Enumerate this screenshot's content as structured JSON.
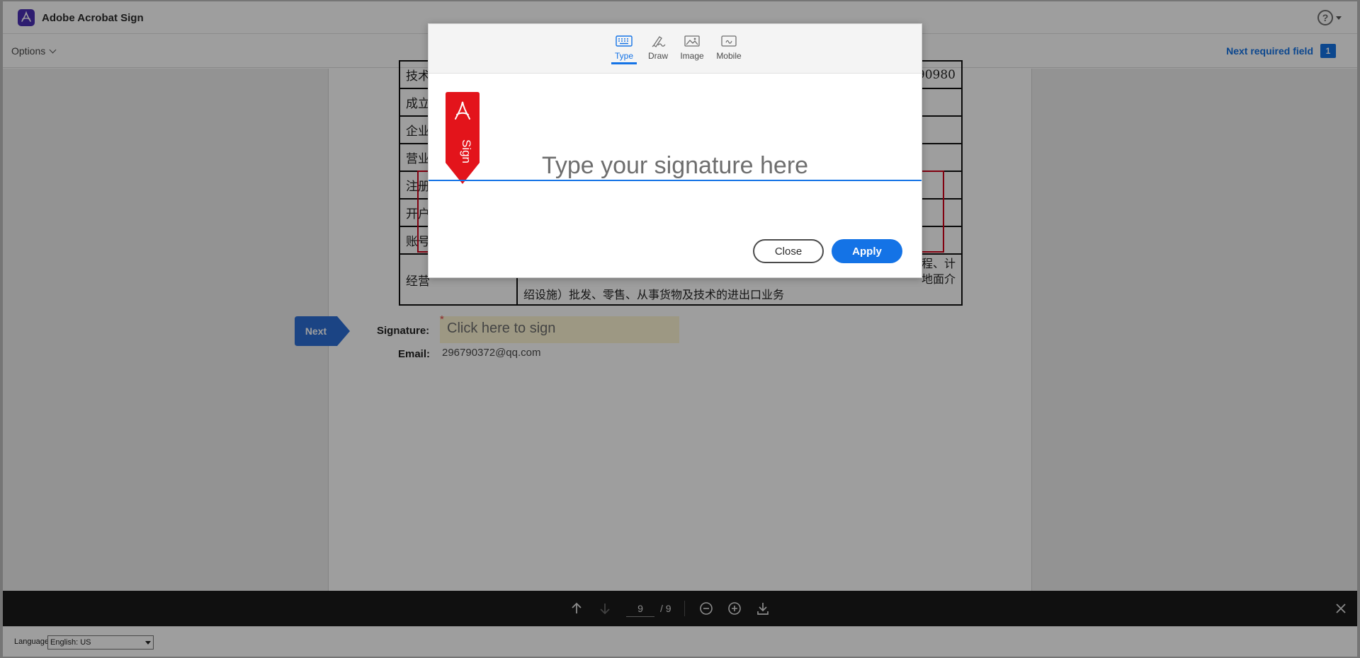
{
  "app": {
    "title": "Adobe Acrobat Sign",
    "help_icon": "help-icon"
  },
  "toolbar": {
    "options_label": "Options",
    "next_required_label": "Next required field",
    "next_required_count": "1"
  },
  "document": {
    "table_rows": [
      {
        "label": "技术",
        "value": ""
      },
      {
        "label": "成立",
        "value": ""
      },
      {
        "label": "企业",
        "value": ""
      },
      {
        "label": "营业",
        "value": ""
      },
      {
        "label": "注册",
        "value": ""
      },
      {
        "label": "开户",
        "value": ""
      },
      {
        "label": "账号",
        "value": ""
      }
    ],
    "business_label": "经营",
    "business_text_line1": "程、计",
    "business_text_line2": "地面介",
    "business_text_line3": "绍设施）批发、零售、从事货物及技术的进出口业务",
    "trailing_digits": "90980",
    "next_tag_label": "Next",
    "signature_label": "Signature:",
    "signature_placeholder": "Click here to sign",
    "required_mark": "*",
    "email_label": "Email:",
    "email_value": "296790372@qq.com"
  },
  "modal": {
    "tabs": [
      {
        "label": "Type",
        "icon": "keyboard-icon",
        "active": true
      },
      {
        "label": "Draw",
        "icon": "pen-icon",
        "active": false
      },
      {
        "label": "Image",
        "icon": "image-icon",
        "active": false
      },
      {
        "label": "Mobile",
        "icon": "mobile-icon",
        "active": false
      }
    ],
    "flag_text": "Sign",
    "signature_placeholder": "Type your signature here",
    "close_label": "Close",
    "apply_label": "Apply"
  },
  "pager": {
    "current_page": "9",
    "total_pages": "/ 9"
  },
  "footer": {
    "language_label": "Language",
    "language_value": "English: US"
  },
  "colors": {
    "accent": "#1473e6",
    "brand_red": "#e3141b",
    "brand_purple": "#4b2fb5"
  }
}
